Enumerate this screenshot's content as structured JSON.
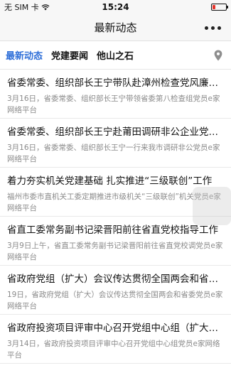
{
  "status_bar": {
    "carrier": "无 SIM 卡",
    "time": "15:24",
    "battery_color": "#e6332a",
    "battery_level": 0.2
  },
  "nav": {
    "title": "最新动态",
    "more_icon": "more-dots-icon"
  },
  "tabs": [
    {
      "label": "最新动态",
      "active": true
    },
    {
      "label": "党建要闻",
      "active": false
    },
    {
      "label": "他山之石",
      "active": false
    }
  ],
  "location_icon": "location-pin-icon",
  "accent_color": "#2f6fd8",
  "news": [
    {
      "title": "省委常委、组织部长王宁带队赴漳州检查党风廉政建设",
      "summary": "3月16日，省委常委、组织部长王宁带领省委第八检查组党员e家网络平台"
    },
    {
      "title": "省委常委、组织部长王宁赴莆田调研非公企业党建工作",
      "summary": "3月16日，省委常委、组织部长王宁一行来我市调研非公党员e家网络平台"
    },
    {
      "title": "着力夯实机关党建基础 扎实推进“三级联创”工作",
      "summary": "福州市委市直机关工委定期推进市级机关“三级联创”机关党员e家网络平台"
    },
    {
      "title": "省直工委常务副书记梁晋阳前往省直党校指导工作",
      "summary": "3月9日上午，省直工委常务副书记梁晋阳前往省直党校调党员e家网络平台"
    },
    {
      "title": "省政府党组（扩大）会议传达贯彻全国两会和省委会议精神",
      "summary": "19日，省政府党组（扩大）会议传达贯彻全国两会和省委党员e家网络平台"
    },
    {
      "title": "省政府投资项目评审中心召开党组中心组（扩大）学习会",
      "summary": "3月14日，省政府投资项目评审中心召开党组中心组党员e家网络平台"
    }
  ]
}
